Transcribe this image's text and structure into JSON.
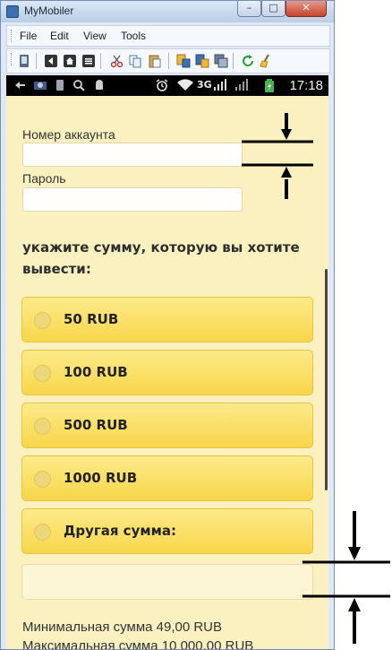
{
  "window": {
    "title": "MyMobiler",
    "min_glyph": "–",
    "max_glyph": "□",
    "close_glyph": "✕"
  },
  "menu": [
    "File",
    "Edit",
    "View",
    "Tools"
  ],
  "toolbar_icons": [
    "device-icon",
    "back-icon",
    "home-icon",
    "menu-icon",
    "cut-icon",
    "copy-icon",
    "paste-icon",
    "copy-to-device-icon",
    "copy-from-device-icon",
    "screenshot-icon",
    "refresh-icon",
    "clean-icon"
  ],
  "statusbar": {
    "time": "17:18",
    "network": "3G",
    "icons": [
      "usb-icon",
      "gallery-icon",
      "sim-icon",
      "search-icon",
      "android-icon",
      "alarm-icon",
      "wifi-icon",
      "signal-icon",
      "battery-icon"
    ]
  },
  "form": {
    "account_label": "Номер аккаунта",
    "account_value": "",
    "password_label": "Пароль",
    "password_value": "",
    "heading": "укажите сумму, которую вы хотите вывести:",
    "options": [
      "50 RUB",
      "100 RUB",
      "500 RUB",
      "1000 RUB",
      "Другая сумма:"
    ],
    "other_amount_value": "",
    "min_text": "Минимальная сумма 49,00 RUB",
    "max_text": "Максимальная сумма 10 000,00 RUB"
  },
  "colors": {
    "page_bg": "#fbf1c0",
    "option_bg": "#f8d64a",
    "statusbar_bg": "#000000"
  }
}
